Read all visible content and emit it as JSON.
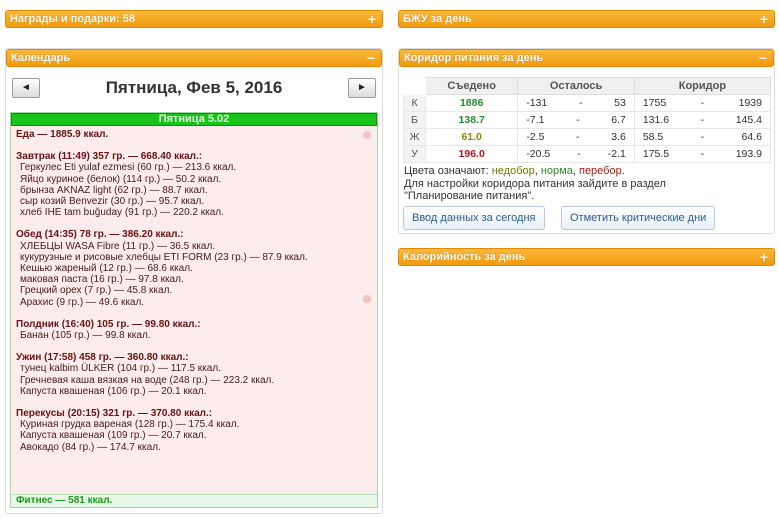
{
  "panels": {
    "awards": {
      "title": "Награды и подарки: 58",
      "toggle": "+"
    },
    "calendar": {
      "title": "Календарь",
      "toggle": "−"
    },
    "bju": {
      "title": "БЖУ за день",
      "toggle": "+"
    },
    "corridor": {
      "title": "Коридор питания за день",
      "toggle": "−"
    },
    "calories": {
      "title": "Калорийность за день",
      "toggle": "+"
    }
  },
  "calendar": {
    "prev_label": "◄",
    "next_label": "►",
    "date": "Пятница, Фев 5, 2016",
    "day_title": "Пятница 5.02",
    "food_total": "Еда — 1885.9 ккал.",
    "meals": [
      {
        "header": "Завтрак (11:49) 357 гр. — 668.40 ккал.:",
        "items": [
          "Геркулес Eti yulaf ezmesi (60 гр.) — 213.6 ккал.",
          "Яйцо куриное (белок) (114 гр.) — 50.2 ккал.",
          "брынза AKNAZ light (62 гр.) — 88.7 ккал.",
          "сыр козий Benvezir (30 гр.) — 95.7 ккал.",
          "хлеб IHE tam buğuday (91 гр.) — 220.2 ккал."
        ]
      },
      {
        "header": "Обед (14:35) 78 гр. — 386.20 ккал.:",
        "items": [
          "ХЛЕБЦЫ WASA Fibre (11 гр.) — 36.5 ккал.",
          "кукурузные и рисовые хлебцы ETI FORM (23 гр.) — 87.9 ккал.",
          "Кешью жареный (12 гр.) — 68.6 ккал.",
          "маковая паста (16 гр.) — 97.8 ккал.",
          "Грецкий орех (7 гр.) — 45.8 ккал.",
          "Арахис (9 гр.) — 49.6 ккал."
        ]
      },
      {
        "header": "Полдник (16:40) 105 гр. — 99.80 ккал.:",
        "items": [
          "Банан (105 гр.) — 99.8 ккал."
        ]
      },
      {
        "header": "Ужин (17:58) 458 гр. — 360.80 ккал.:",
        "items": [
          "тунец kalbim ÜLKER (104 гр.) — 117.5 ккал.",
          "Гречневая каша вязкая на воде (248 гр.) — 223.2 ккал.",
          "Капуста квашеная (106 гр.) — 20.1 ккал."
        ]
      },
      {
        "header": "Перекусы (20:15) 321 гр. — 370.80 ккал.:",
        "items": [
          "Куриная грудка вареная (128 гр.) — 175.4 ккал.",
          "Капуста квашеная (109 гр.) — 20.7 ккал.",
          "Авокадо (84 гр.) — 174.7 ккал."
        ]
      }
    ],
    "fitness": "Фитнес — 581 ккал."
  },
  "corridor": {
    "headers": [
      "Съедено",
      "Осталось",
      "Коридор"
    ],
    "rows": [
      {
        "label": "К",
        "eaten": "1886",
        "eaten_class": "c-green",
        "left_min": "-131",
        "dash": "-",
        "left_max": "53",
        "corr_min": "1755",
        "corr_max": "1939"
      },
      {
        "label": "Б",
        "eaten": "138.7",
        "eaten_class": "c-green",
        "left_min": "-7.1",
        "dash": "-",
        "left_max": "6.7",
        "corr_min": "131.6",
        "corr_max": "145.4"
      },
      {
        "label": "Ж",
        "eaten": "61.0",
        "eaten_class": "c-olive",
        "left_min": "-2.5",
        "dash": "-",
        "left_max": "3.6",
        "corr_min": "58.5",
        "corr_max": "64.6"
      },
      {
        "label": "У",
        "eaten": "196.0",
        "eaten_class": "c-red",
        "left_min": "-20.5",
        "dash": "-",
        "left_max": "-2.1",
        "corr_min": "175.5",
        "corr_max": "193.9"
      }
    ],
    "legend_prefix": "Цвета означают: ",
    "legend_under": "недобор",
    "legend_norm": "норма",
    "legend_over": "перебор",
    "legend_sep": ", ",
    "legend_end": ".",
    "hint_line1": "Для настройки коридора питания зайдите в раздел",
    "hint_line2": "\"Планирование питания\".",
    "btn_enter": "Ввод данных за сегодня",
    "btn_critical": "Отметить критические дни"
  },
  "colors": {
    "header_orange": "#f29a0f",
    "green": "#2a8a2a",
    "olive": "#8a8a00",
    "red": "#b01515",
    "day_bg": "#fdecec"
  }
}
